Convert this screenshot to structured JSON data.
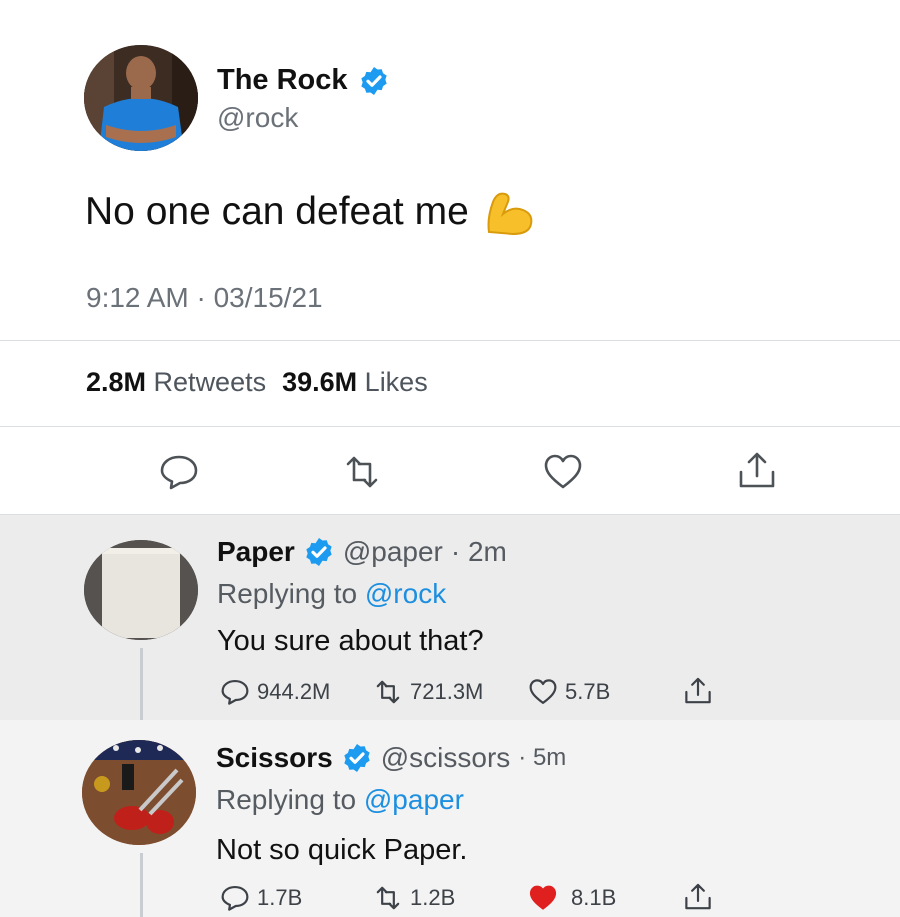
{
  "main_tweet": {
    "author_name": "The Rock",
    "author_handle": "@rock",
    "text": "No one can defeat me",
    "emoji_icon": "flexed-biceps-emoji",
    "timestamp": "9:12 AM · 03/15/21",
    "retweets_count": "2.8M",
    "retweets_label": "Retweets",
    "likes_count": "39.6M",
    "likes_label": "Likes",
    "actions": [
      "reply-icon",
      "retweet-icon",
      "like-icon",
      "share-icon"
    ]
  },
  "replies": [
    {
      "author_name": "Paper",
      "author_handle": "@paper",
      "time": "· 2m",
      "replying_prefix": "Replying to",
      "replying_to": "@rock",
      "text": "You sure about that?",
      "reply_count": "944.2M",
      "retweet_count": "721.3M",
      "like_count": "5.7B",
      "liked": false
    },
    {
      "author_name": "Scissors",
      "author_handle": "@scissors",
      "time": "· 5m",
      "replying_prefix": "Replying to",
      "replying_to": "@paper",
      "text": "Not so quick Paper.",
      "reply_count": "1.7B",
      "retweet_count": "1.2B",
      "like_count": "8.1B",
      "liked": true
    }
  ],
  "colors": {
    "verified_blue": "#1d9bf0",
    "mention_blue": "#1d8fe0",
    "liked_red": "#e0245e"
  }
}
